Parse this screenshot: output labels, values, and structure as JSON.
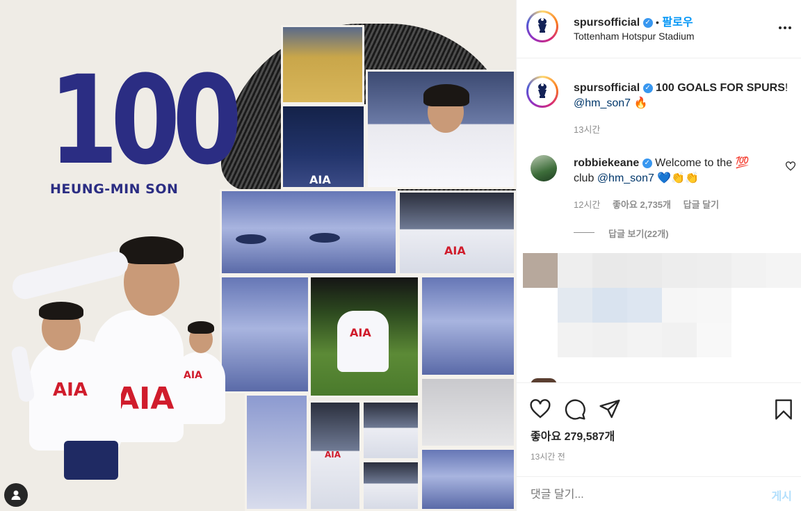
{
  "poster": {
    "number": "100",
    "name": "HEUNG-MIN SON",
    "kit_sponsor": "AIA"
  },
  "header": {
    "username": "spursofficial",
    "separator": "•",
    "follow_label": "팔로우",
    "location": "Tottenham Hotspur Stadium",
    "more_icon": "more-horizontal-icon"
  },
  "caption": {
    "username": "spursofficial",
    "text": "100 GOALS FOR SPURS",
    "exclaim": "!",
    "mention": "@hm_son7",
    "emoji": "🔥",
    "time": "13시간"
  },
  "comment": {
    "username": "robbiekeane",
    "text_line1": "Welcome to the 💯",
    "text_line2_prefix": "club",
    "mention": "@hm_son7",
    "emojis": "💙👏👏",
    "time": "12시간",
    "likes": "좋아요 2,735개",
    "reply_label": "답글 달기",
    "view_replies": "답글 보기(22개)"
  },
  "actions": {
    "likes_label": "좋아요 279,587개",
    "timestamp": "13시간 전"
  },
  "composer": {
    "placeholder": "댓글 달기...",
    "post_label": "게시"
  },
  "colors": {
    "accent": "#0095f6",
    "poster_navy": "#2b2d83",
    "verified": "#3897f0"
  }
}
